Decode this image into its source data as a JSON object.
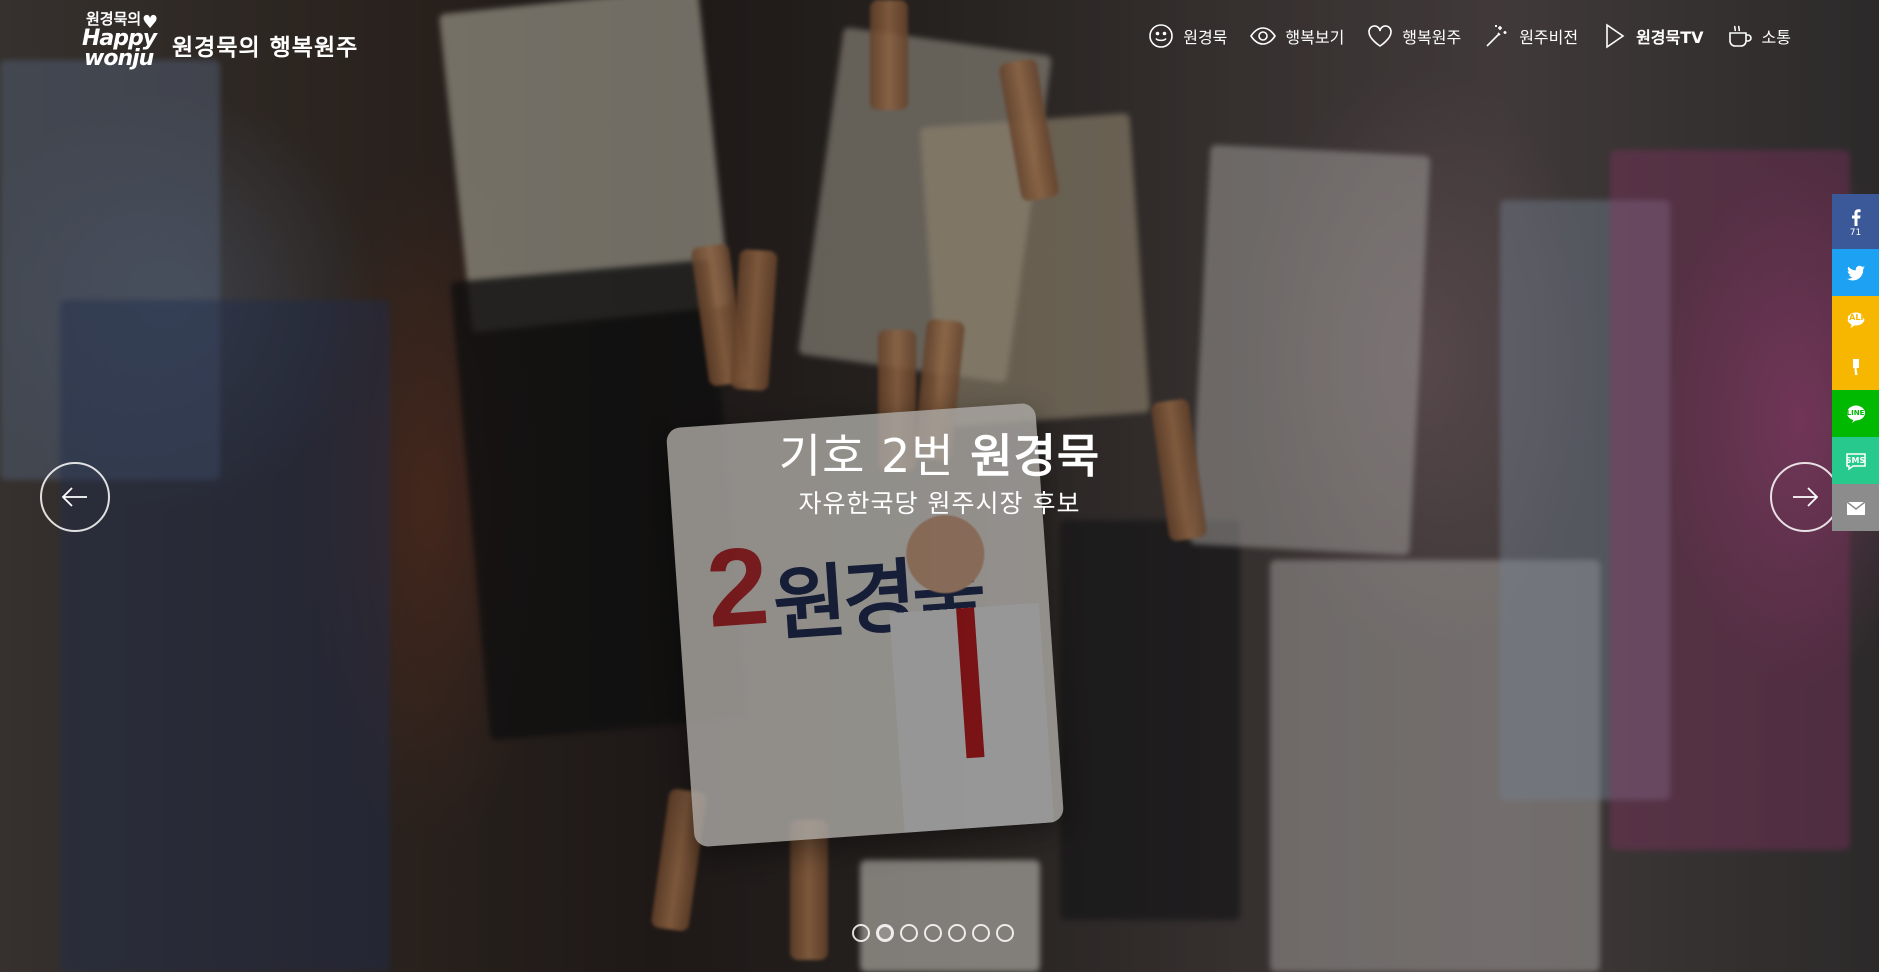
{
  "header": {
    "logo": {
      "line1": "원경묵의",
      "line2": "Happy",
      "line3": "wonju"
    },
    "site_title": "원경묵의 행복원주"
  },
  "nav": [
    {
      "label": "원경묵",
      "icon": "smiley-icon"
    },
    {
      "label": "행복보기",
      "icon": "eye-icon"
    },
    {
      "label": "행복원주",
      "icon": "heart-icon"
    },
    {
      "label": "원주비전",
      "icon": "magic-wand-icon"
    },
    {
      "label": "원경묵TV",
      "icon": "play-icon"
    },
    {
      "label": "소통",
      "icon": "coffee-cup-icon"
    }
  ],
  "hero": {
    "title_prefix": "기호 2번 ",
    "title_name": "원경묵",
    "subtitle": "자유한국당 원주시장 후보"
  },
  "poster": {
    "number": "2",
    "name": "원경묵"
  },
  "slider": {
    "dot_count": 7,
    "active_index": 1
  },
  "share": {
    "facebook_count": "71",
    "sms_label": "SMS",
    "talk_label": "TALK",
    "line_label": "LINE",
    "colors": {
      "facebook": "#3b5998",
      "twitter": "#1da1f2",
      "kakao": "#f7b600",
      "line": "#00b900",
      "sms": "#27c98c",
      "mail": "#8c8c8c"
    }
  }
}
